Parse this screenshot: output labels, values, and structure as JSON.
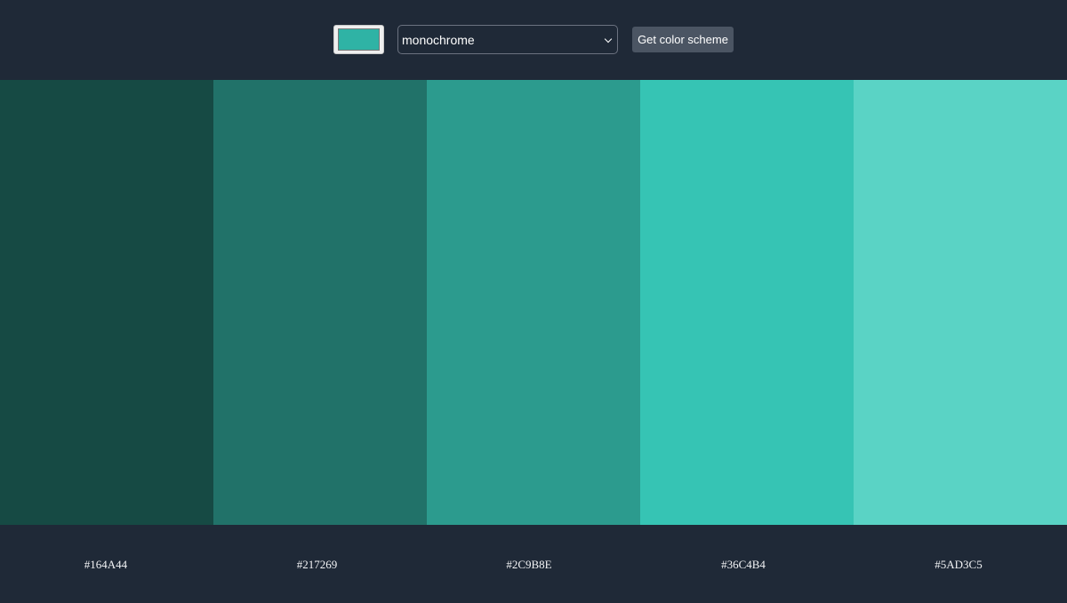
{
  "controls": {
    "seed_color": "#2fb3a5",
    "scheme_mode": "monochrome",
    "button_label": "Get color scheme"
  },
  "palette": {
    "colors": [
      {
        "hex": "#164A44",
        "label": "#164A44"
      },
      {
        "hex": "#217269",
        "label": "#217269"
      },
      {
        "hex": "#2C9B8E",
        "label": "#2C9B8E"
      },
      {
        "hex": "#36C4B4",
        "label": "#36C4B4"
      },
      {
        "hex": "#5AD3C5",
        "label": "#5AD3C5"
      }
    ]
  },
  "theme": {
    "background": "#1f2937",
    "button_background": "#4b5563",
    "text": "#f3f4f6"
  }
}
